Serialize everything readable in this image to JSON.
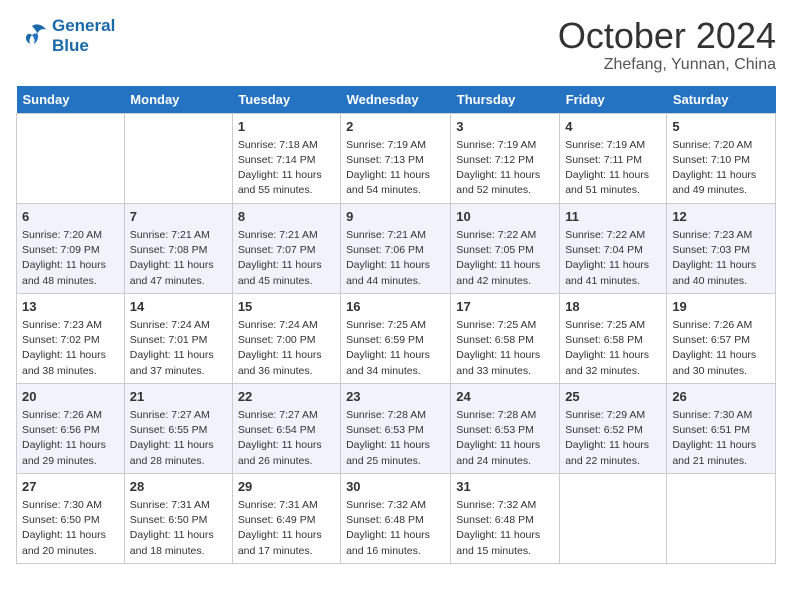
{
  "header": {
    "logo_line1": "General",
    "logo_line2": "Blue",
    "month_title": "October 2024",
    "location": "Zhefang, Yunnan, China"
  },
  "weekdays": [
    "Sunday",
    "Monday",
    "Tuesday",
    "Wednesday",
    "Thursday",
    "Friday",
    "Saturday"
  ],
  "weeks": [
    [
      {
        "day": "",
        "info": ""
      },
      {
        "day": "",
        "info": ""
      },
      {
        "day": "1",
        "info": "Sunrise: 7:18 AM\nSunset: 7:14 PM\nDaylight: 11 hours and 55 minutes."
      },
      {
        "day": "2",
        "info": "Sunrise: 7:19 AM\nSunset: 7:13 PM\nDaylight: 11 hours and 54 minutes."
      },
      {
        "day": "3",
        "info": "Sunrise: 7:19 AM\nSunset: 7:12 PM\nDaylight: 11 hours and 52 minutes."
      },
      {
        "day": "4",
        "info": "Sunrise: 7:19 AM\nSunset: 7:11 PM\nDaylight: 11 hours and 51 minutes."
      },
      {
        "day": "5",
        "info": "Sunrise: 7:20 AM\nSunset: 7:10 PM\nDaylight: 11 hours and 49 minutes."
      }
    ],
    [
      {
        "day": "6",
        "info": "Sunrise: 7:20 AM\nSunset: 7:09 PM\nDaylight: 11 hours and 48 minutes."
      },
      {
        "day": "7",
        "info": "Sunrise: 7:21 AM\nSunset: 7:08 PM\nDaylight: 11 hours and 47 minutes."
      },
      {
        "day": "8",
        "info": "Sunrise: 7:21 AM\nSunset: 7:07 PM\nDaylight: 11 hours and 45 minutes."
      },
      {
        "day": "9",
        "info": "Sunrise: 7:21 AM\nSunset: 7:06 PM\nDaylight: 11 hours and 44 minutes."
      },
      {
        "day": "10",
        "info": "Sunrise: 7:22 AM\nSunset: 7:05 PM\nDaylight: 11 hours and 42 minutes."
      },
      {
        "day": "11",
        "info": "Sunrise: 7:22 AM\nSunset: 7:04 PM\nDaylight: 11 hours and 41 minutes."
      },
      {
        "day": "12",
        "info": "Sunrise: 7:23 AM\nSunset: 7:03 PM\nDaylight: 11 hours and 40 minutes."
      }
    ],
    [
      {
        "day": "13",
        "info": "Sunrise: 7:23 AM\nSunset: 7:02 PM\nDaylight: 11 hours and 38 minutes."
      },
      {
        "day": "14",
        "info": "Sunrise: 7:24 AM\nSunset: 7:01 PM\nDaylight: 11 hours and 37 minutes."
      },
      {
        "day": "15",
        "info": "Sunrise: 7:24 AM\nSunset: 7:00 PM\nDaylight: 11 hours and 36 minutes."
      },
      {
        "day": "16",
        "info": "Sunrise: 7:25 AM\nSunset: 6:59 PM\nDaylight: 11 hours and 34 minutes."
      },
      {
        "day": "17",
        "info": "Sunrise: 7:25 AM\nSunset: 6:58 PM\nDaylight: 11 hours and 33 minutes."
      },
      {
        "day": "18",
        "info": "Sunrise: 7:25 AM\nSunset: 6:58 PM\nDaylight: 11 hours and 32 minutes."
      },
      {
        "day": "19",
        "info": "Sunrise: 7:26 AM\nSunset: 6:57 PM\nDaylight: 11 hours and 30 minutes."
      }
    ],
    [
      {
        "day": "20",
        "info": "Sunrise: 7:26 AM\nSunset: 6:56 PM\nDaylight: 11 hours and 29 minutes."
      },
      {
        "day": "21",
        "info": "Sunrise: 7:27 AM\nSunset: 6:55 PM\nDaylight: 11 hours and 28 minutes."
      },
      {
        "day": "22",
        "info": "Sunrise: 7:27 AM\nSunset: 6:54 PM\nDaylight: 11 hours and 26 minutes."
      },
      {
        "day": "23",
        "info": "Sunrise: 7:28 AM\nSunset: 6:53 PM\nDaylight: 11 hours and 25 minutes."
      },
      {
        "day": "24",
        "info": "Sunrise: 7:28 AM\nSunset: 6:53 PM\nDaylight: 11 hours and 24 minutes."
      },
      {
        "day": "25",
        "info": "Sunrise: 7:29 AM\nSunset: 6:52 PM\nDaylight: 11 hours and 22 minutes."
      },
      {
        "day": "26",
        "info": "Sunrise: 7:30 AM\nSunset: 6:51 PM\nDaylight: 11 hours and 21 minutes."
      }
    ],
    [
      {
        "day": "27",
        "info": "Sunrise: 7:30 AM\nSunset: 6:50 PM\nDaylight: 11 hours and 20 minutes."
      },
      {
        "day": "28",
        "info": "Sunrise: 7:31 AM\nSunset: 6:50 PM\nDaylight: 11 hours and 18 minutes."
      },
      {
        "day": "29",
        "info": "Sunrise: 7:31 AM\nSunset: 6:49 PM\nDaylight: 11 hours and 17 minutes."
      },
      {
        "day": "30",
        "info": "Sunrise: 7:32 AM\nSunset: 6:48 PM\nDaylight: 11 hours and 16 minutes."
      },
      {
        "day": "31",
        "info": "Sunrise: 7:32 AM\nSunset: 6:48 PM\nDaylight: 11 hours and 15 minutes."
      },
      {
        "day": "",
        "info": ""
      },
      {
        "day": "",
        "info": ""
      }
    ]
  ]
}
